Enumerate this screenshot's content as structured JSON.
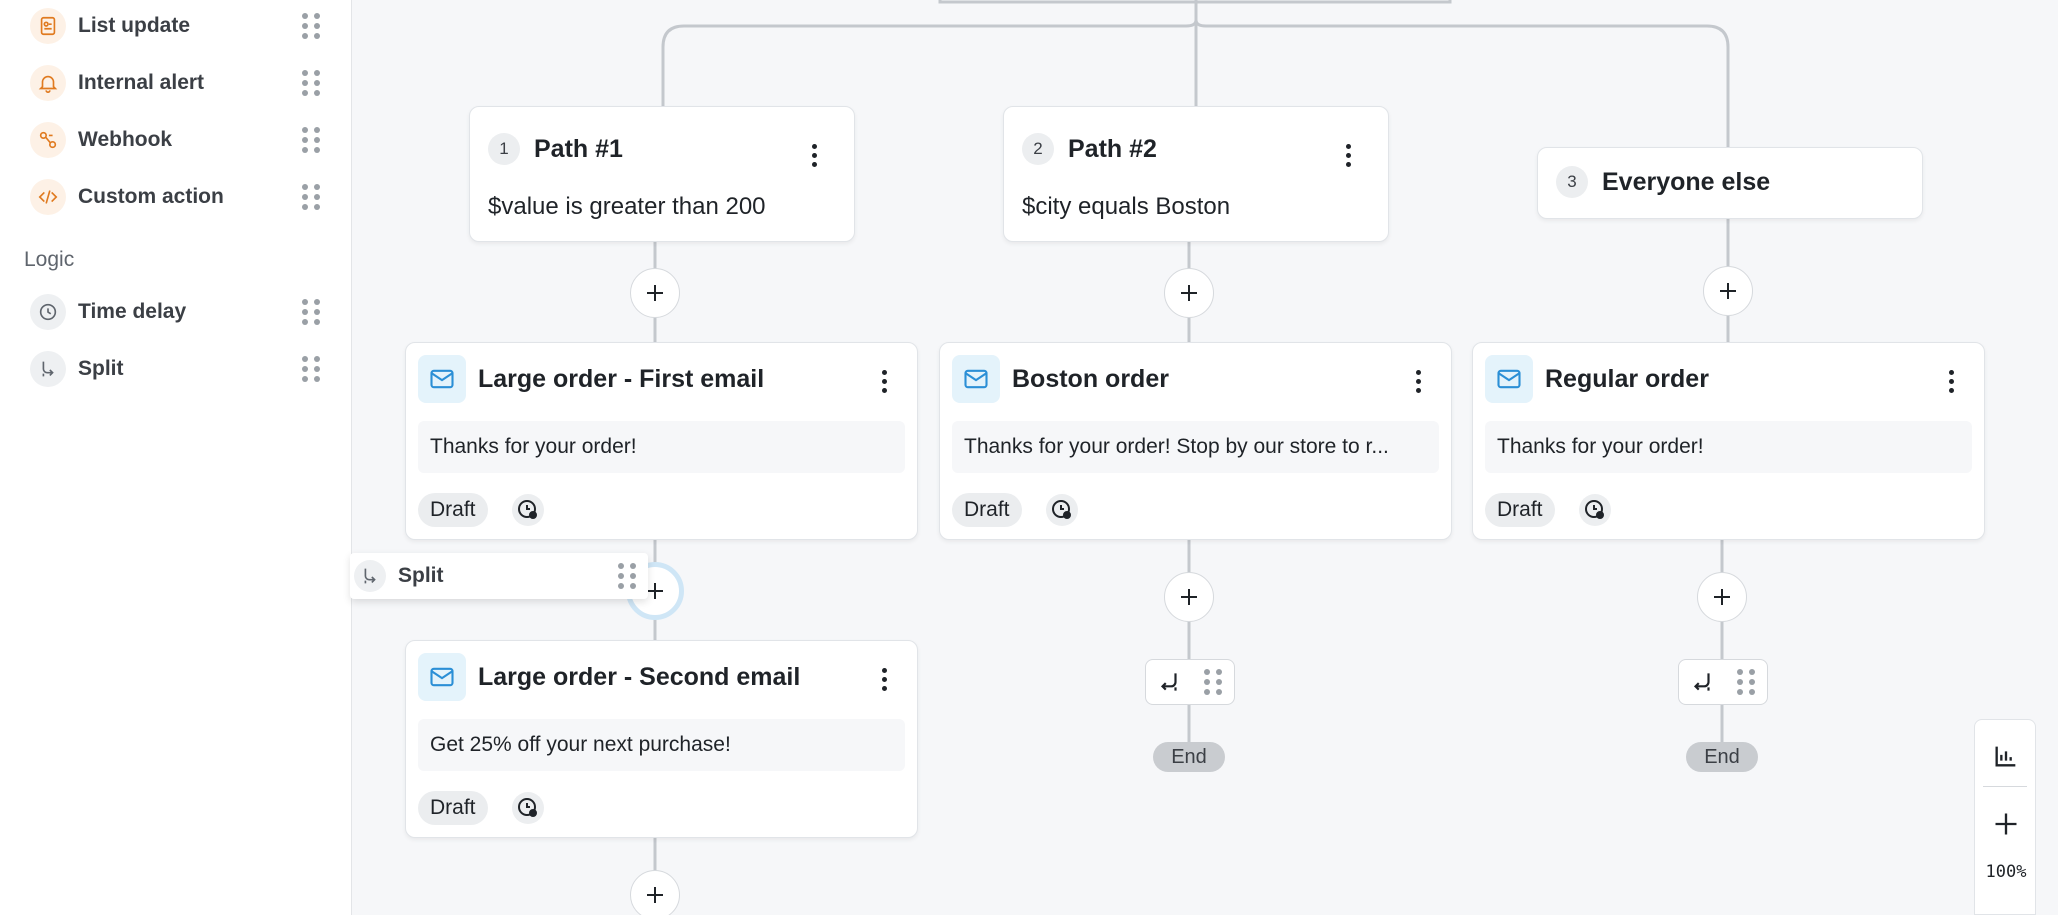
{
  "sidebar": {
    "items": [
      {
        "label": "List update",
        "icon": "list-update-icon"
      },
      {
        "label": "Internal alert",
        "icon": "bell-icon"
      },
      {
        "label": "Webhook",
        "icon": "webhook-icon"
      },
      {
        "label": "Custom action",
        "icon": "code-icon"
      }
    ],
    "logic_section": "Logic",
    "logic_items": [
      {
        "label": "Time delay",
        "icon": "clock-icon"
      },
      {
        "label": "Split",
        "icon": "split-icon"
      }
    ]
  },
  "paths": [
    {
      "num": "1",
      "title": "Path #1",
      "condition": "$value is greater than 200"
    },
    {
      "num": "2",
      "title": "Path #2",
      "condition": "$city equals Boston"
    },
    {
      "num": "3",
      "title": "Everyone else",
      "condition": ""
    }
  ],
  "emails": [
    {
      "title": "Large order - First email",
      "body": "Thanks for your order!",
      "status": "Draft"
    },
    {
      "title": "Boston order",
      "body": "Thanks for your order! Stop by our store to r...",
      "status": "Draft"
    },
    {
      "title": "Regular order",
      "body": "Thanks for your order!",
      "status": "Draft"
    },
    {
      "title": "Large order - Second email",
      "body": "Get 25% off your next purchase!",
      "status": "Draft"
    }
  ],
  "end_label": "End",
  "drag_ghost": {
    "label": "Split"
  },
  "zoom": {
    "level": "100%"
  },
  "colors": {
    "accent_orange": "#e07a1f",
    "email_blue": "#2b8fd6",
    "connector": "#c4c8cd"
  }
}
